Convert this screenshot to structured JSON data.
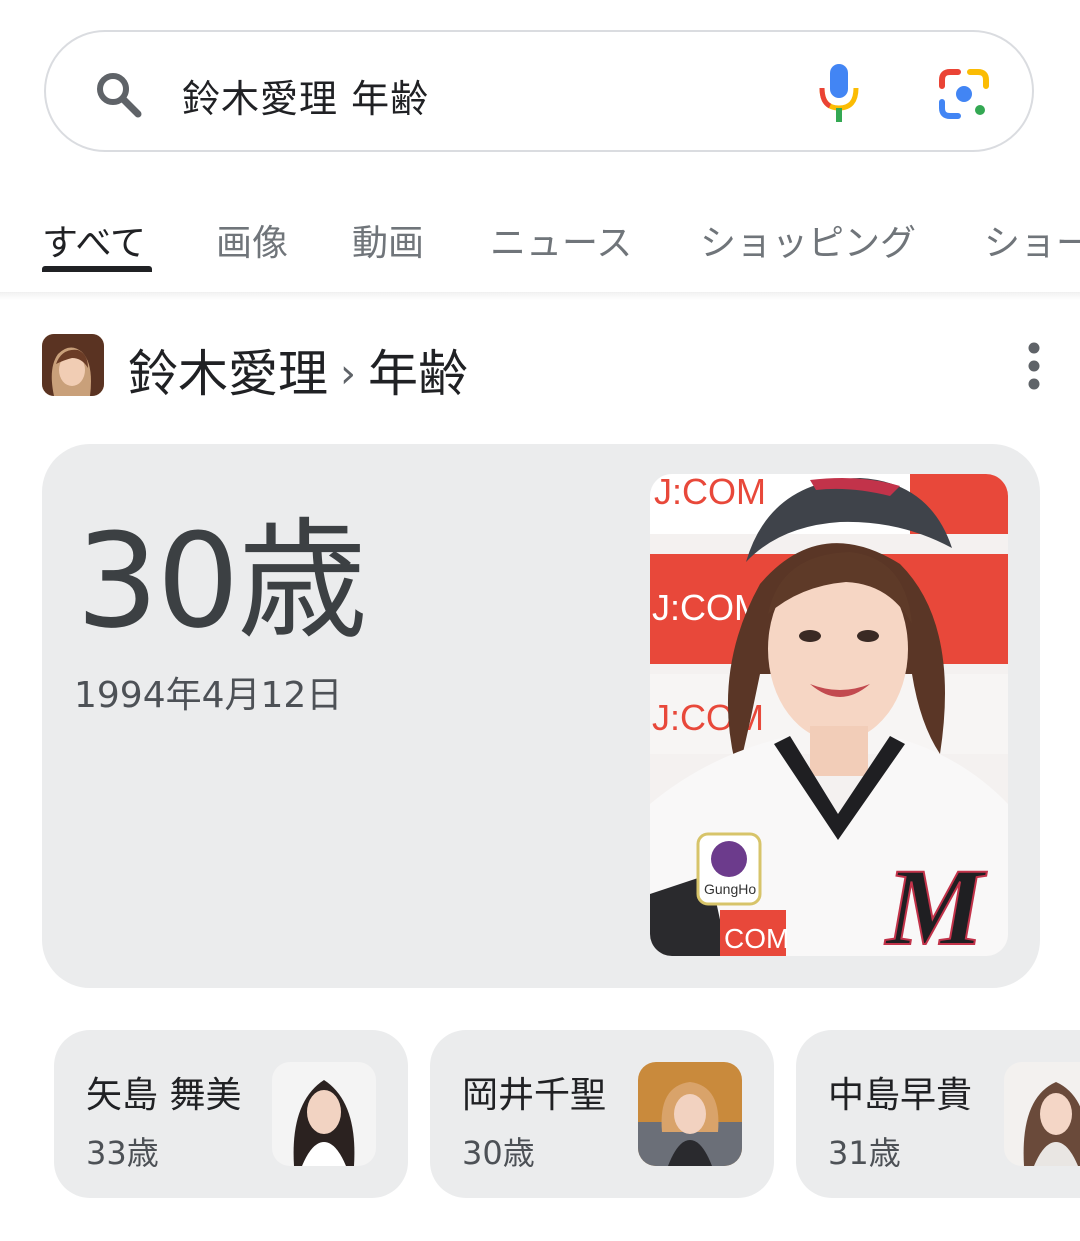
{
  "search": {
    "query": "鈴木愛理 年齢"
  },
  "tabs": [
    {
      "label": "すべて",
      "active": true
    },
    {
      "label": "画像"
    },
    {
      "label": "動画"
    },
    {
      "label": "ニュース"
    },
    {
      "label": "ショッピング"
    },
    {
      "label": "ショート動画"
    }
  ],
  "header": {
    "entity": "鈴木愛理",
    "separator": "›",
    "attribute": "年齢"
  },
  "answer": {
    "age": "30歳",
    "birth_date": "1994年4月12日",
    "photo_text": {
      "backdrop": "J:COM",
      "badge": "GungHo",
      "jersey_letter": "M"
    }
  },
  "related": [
    {
      "name": "矢島 舞美",
      "age": "33歳"
    },
    {
      "name": "岡井千聖",
      "age": "30歳"
    },
    {
      "name": "中島早貴",
      "age": "31歳"
    }
  ],
  "icons": {
    "search": "search-icon",
    "mic": "mic-icon",
    "lens": "lens-icon",
    "more": "more-vert-icon"
  },
  "colors": {
    "card_bg": "#ebeced",
    "google_blue": "#4285f4",
    "google_red": "#ea4335",
    "google_yellow": "#fbbc04",
    "google_green": "#34a853"
  }
}
